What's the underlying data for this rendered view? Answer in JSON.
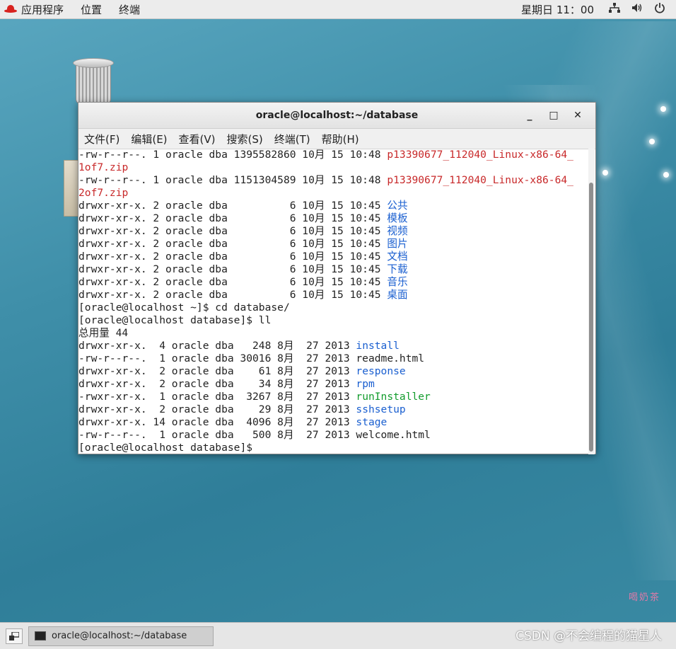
{
  "top_bar": {
    "applications": "应用程序",
    "places": "位置",
    "terminal": "终端",
    "clock": "星期日 11：00",
    "network_icon": "network-icon",
    "volume_icon": "volume-icon",
    "power_icon": "power-icon"
  },
  "desktop": {
    "trash_icon": "trash-icon",
    "watermark": "CSDN @不会编程的猫星人",
    "sticker_text": "喝奶茶"
  },
  "window": {
    "title": "oracle@localhost:~/database",
    "minimize": "_",
    "maximize": "□",
    "close": "✕",
    "menu": [
      {
        "label": "文件(F)"
      },
      {
        "label": "编辑(E)"
      },
      {
        "label": "查看(V)"
      },
      {
        "label": "搜索(S)"
      },
      {
        "label": "终端(T)"
      },
      {
        "label": "帮助(H)"
      }
    ]
  },
  "terminal": {
    "lines": [
      {
        "parts": [
          {
            "t": "-rw-r--r--. 1 oracle dba 1395582860 10月 15 10:48 "
          },
          {
            "t": "p13390677_112040_Linux-x86-64_",
            "c": "red"
          }
        ]
      },
      {
        "parts": [
          {
            "t": "1of7.zip",
            "c": "red"
          }
        ]
      },
      {
        "parts": [
          {
            "t": "-rw-r--r--. 1 oracle dba 1151304589 10月 15 10:48 "
          },
          {
            "t": "p13390677_112040_Linux-x86-64_",
            "c": "red"
          }
        ]
      },
      {
        "parts": [
          {
            "t": "2of7.zip",
            "c": "red"
          }
        ]
      },
      {
        "parts": [
          {
            "t": "drwxr-xr-x. 2 oracle dba          6 10月 15 10:45 "
          },
          {
            "t": "公共",
            "c": "blue"
          }
        ]
      },
      {
        "parts": [
          {
            "t": "drwxr-xr-x. 2 oracle dba          6 10月 15 10:45 "
          },
          {
            "t": "模板",
            "c": "blue"
          }
        ]
      },
      {
        "parts": [
          {
            "t": "drwxr-xr-x. 2 oracle dba          6 10月 15 10:45 "
          },
          {
            "t": "视频",
            "c": "blue"
          }
        ]
      },
      {
        "parts": [
          {
            "t": "drwxr-xr-x. 2 oracle dba          6 10月 15 10:45 "
          },
          {
            "t": "图片",
            "c": "blue"
          }
        ]
      },
      {
        "parts": [
          {
            "t": "drwxr-xr-x. 2 oracle dba          6 10月 15 10:45 "
          },
          {
            "t": "文档",
            "c": "blue"
          }
        ]
      },
      {
        "parts": [
          {
            "t": "drwxr-xr-x. 2 oracle dba          6 10月 15 10:45 "
          },
          {
            "t": "下载",
            "c": "blue"
          }
        ]
      },
      {
        "parts": [
          {
            "t": "drwxr-xr-x. 2 oracle dba          6 10月 15 10:45 "
          },
          {
            "t": "音乐",
            "c": "blue"
          }
        ]
      },
      {
        "parts": [
          {
            "t": "drwxr-xr-x. 2 oracle dba          6 10月 15 10:45 "
          },
          {
            "t": "桌面",
            "c": "blue"
          }
        ]
      },
      {
        "parts": [
          {
            "t": "[oracle@localhost ~]$ cd database/"
          }
        ]
      },
      {
        "parts": [
          {
            "t": "[oracle@localhost database]$ ll"
          }
        ]
      },
      {
        "parts": [
          {
            "t": "总用量 44"
          }
        ]
      },
      {
        "parts": [
          {
            "t": "drwxr-xr-x.  4 oracle dba   248 8月  27 2013 "
          },
          {
            "t": "install",
            "c": "blue"
          }
        ]
      },
      {
        "parts": [
          {
            "t": "-rw-r--r--.  1 oracle dba 30016 8月  27 2013 readme.html"
          }
        ]
      },
      {
        "parts": [
          {
            "t": "drwxr-xr-x.  2 oracle dba    61 8月  27 2013 "
          },
          {
            "t": "response",
            "c": "blue"
          }
        ]
      },
      {
        "parts": [
          {
            "t": "drwxr-xr-x.  2 oracle dba    34 8月  27 2013 "
          },
          {
            "t": "rpm",
            "c": "blue"
          }
        ]
      },
      {
        "parts": [
          {
            "t": "-rwxr-xr-x.  1 oracle dba  3267 8月  27 2013 "
          },
          {
            "t": "runInstaller",
            "c": "green"
          }
        ]
      },
      {
        "parts": [
          {
            "t": "drwxr-xr-x.  2 oracle dba    29 8月  27 2013 "
          },
          {
            "t": "sshsetup",
            "c": "blue"
          }
        ]
      },
      {
        "parts": [
          {
            "t": "drwxr-xr-x. 14 oracle dba  4096 8月  27 2013 "
          },
          {
            "t": "stage",
            "c": "blue"
          }
        ]
      },
      {
        "parts": [
          {
            "t": "-rw-r--r--.  1 oracle dba   500 8月  27 2013 welcome.html"
          }
        ]
      },
      {
        "parts": [
          {
            "t": "[oracle@localhost database]$ "
          }
        ]
      }
    ]
  },
  "taskbar": {
    "show_desktop_icon": "show-desktop-icon",
    "task_label": "oracle@localhost:~/database",
    "task_icon": "terminal-icon"
  }
}
